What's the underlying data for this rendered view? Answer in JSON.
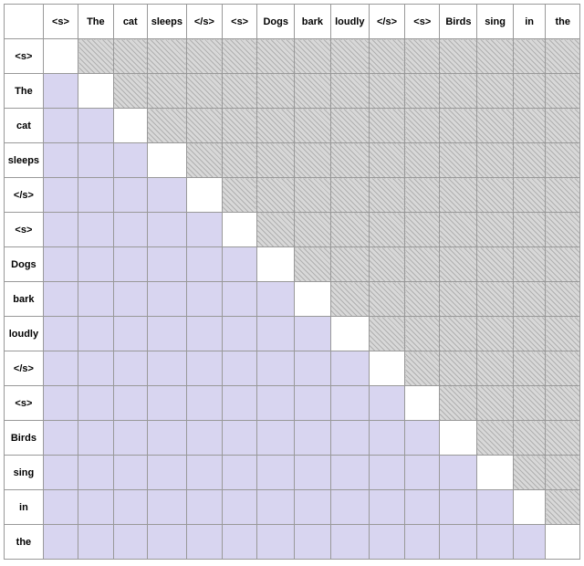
{
  "headers": [
    "<s>",
    "The",
    "cat",
    "sleeps",
    "</s>",
    "<s>",
    "Dogs",
    "bark",
    "loudly",
    "</s>",
    "<s>",
    "Birds",
    "sing",
    "in",
    "the"
  ],
  "rows": [
    "<s>",
    "The",
    "cat",
    "sleeps",
    "</s>",
    "<s>",
    "Dogs",
    "bark",
    "loudly",
    "</s>",
    "<s>",
    "Birds",
    "sing",
    "in",
    "the"
  ]
}
